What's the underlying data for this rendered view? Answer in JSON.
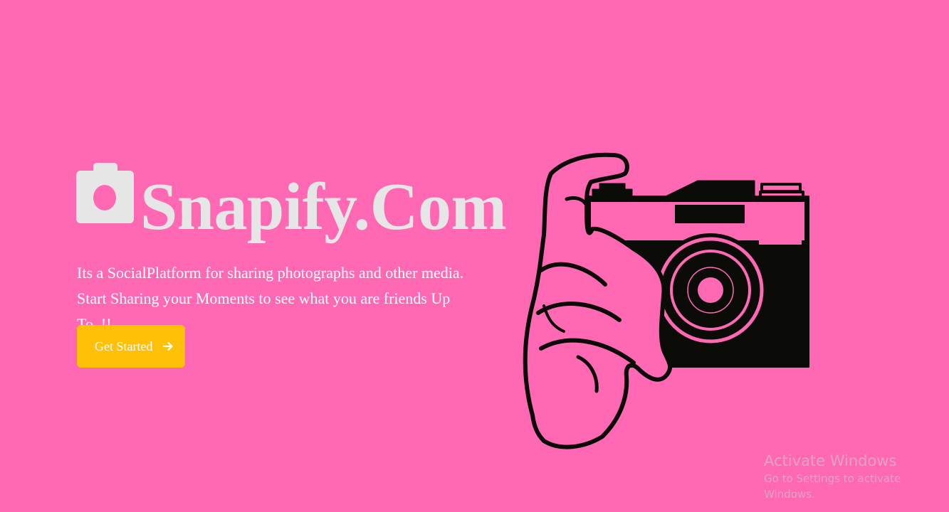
{
  "brand": {
    "icon": "camera-icon",
    "name": "Snapify.Com"
  },
  "hero": {
    "tagline": "Its a SocialPlatform for sharing photographs and other media. Start Sharing your Moments to see what you are friends Up To..!!",
    "cta_label": "Get Started",
    "cta_icon": "arrow-right-icon",
    "illustration": "hand-holding-camera-illustration"
  },
  "watermark": {
    "title": "Activate Windows",
    "subtitle": "Go to Settings to activate Windows."
  },
  "colors": {
    "background": "#ff69b4",
    "brand_text": "#e6e6e6",
    "cta_background": "#ffc107",
    "illustration_ink": "#0b0b08"
  }
}
